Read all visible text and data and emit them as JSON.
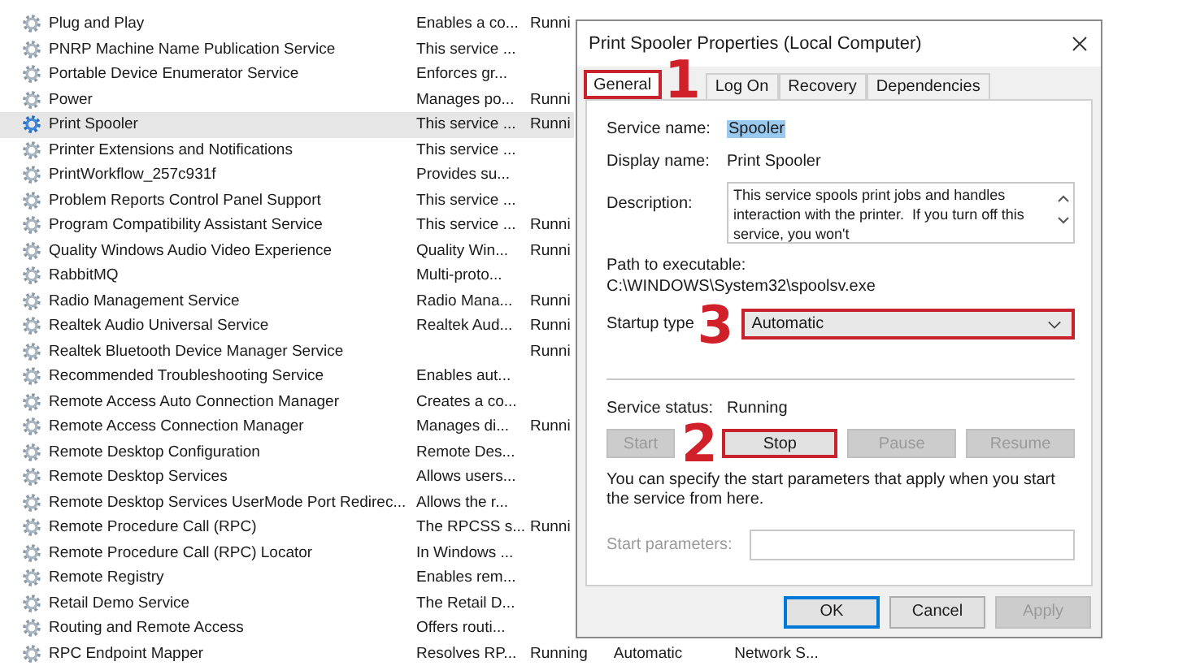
{
  "services": [
    {
      "name": "Plug and Play",
      "description": "Enables a co...",
      "status": "Runni",
      "selected": false
    },
    {
      "name": "PNRP Machine Name Publication Service",
      "description": "This service ...",
      "selected": false
    },
    {
      "name": "Portable Device Enumerator Service",
      "description": "Enforces gr...",
      "selected": false
    },
    {
      "name": "Power",
      "description": "Manages po...",
      "status": "Runni",
      "selected": false
    },
    {
      "name": "Print Spooler",
      "description": "This service ...",
      "status": "Runni",
      "selected": true
    },
    {
      "name": "Printer Extensions and Notifications",
      "description": "This service ...",
      "selected": false
    },
    {
      "name": "PrintWorkflow_257c931f",
      "description": "Provides su...",
      "selected": false
    },
    {
      "name": "Problem Reports Control Panel Support",
      "description": "This service ...",
      "selected": false
    },
    {
      "name": "Program Compatibility Assistant Service",
      "description": "This service ...",
      "status": "Runni",
      "selected": false
    },
    {
      "name": "Quality Windows Audio Video Experience",
      "description": "Quality Win...",
      "status": "Runni",
      "selected": false
    },
    {
      "name": "RabbitMQ",
      "description": "Multi-proto...",
      "selected": false
    },
    {
      "name": "Radio Management Service",
      "description": "Radio Mana...",
      "status": "Runni",
      "selected": false
    },
    {
      "name": "Realtek Audio Universal Service",
      "description": "Realtek Aud...",
      "status": "Runni",
      "selected": false
    },
    {
      "name": "Realtek Bluetooth Device Manager Service",
      "status": "Runni",
      "selected": false
    },
    {
      "name": "Recommended Troubleshooting Service",
      "description": "Enables aut...",
      "selected": false
    },
    {
      "name": "Remote Access Auto Connection Manager",
      "description": "Creates a co...",
      "selected": false
    },
    {
      "name": "Remote Access Connection Manager",
      "description": "Manages di...",
      "status": "Runni",
      "selected": false
    },
    {
      "name": "Remote Desktop Configuration",
      "description": "Remote Des...",
      "selected": false
    },
    {
      "name": "Remote Desktop Services",
      "description": "Allows users...",
      "selected": false
    },
    {
      "name": "Remote Desktop Services UserMode Port Redirec...",
      "description": "Allows the r...",
      "selected": false
    },
    {
      "name": "Remote Procedure Call (RPC)",
      "description": "The RPCSS s...",
      "status": "Runni",
      "selected": false
    },
    {
      "name": "Remote Procedure Call (RPC) Locator",
      "description": "In Windows ...",
      "selected": false
    },
    {
      "name": "Remote Registry",
      "description": "Enables rem...",
      "selected": false
    },
    {
      "name": "Retail Demo Service",
      "description": "The Retail D...",
      "selected": false
    },
    {
      "name": "Routing and Remote Access",
      "description": "Offers routi...",
      "selected": false
    },
    {
      "name": "RPC Endpoint Mapper",
      "description": "Resolves RP...",
      "status": "Running",
      "startup_type": "Automatic",
      "log_on_as": "Network S...",
      "selected": false
    }
  ],
  "dialog": {
    "title": "Print Spooler Properties (Local Computer)",
    "tabs": [
      {
        "label": "General",
        "selected": true,
        "highlighted": true,
        "step": "1"
      },
      {
        "label": "Log On",
        "selected": false,
        "highlighted": false
      },
      {
        "label": "Recovery",
        "selected": false,
        "highlighted": false
      },
      {
        "label": "Dependencies",
        "selected": false,
        "highlighted": false
      }
    ],
    "service_name": {
      "label": "Service name:",
      "value": "Spooler",
      "value_selected": true
    },
    "display_name": {
      "label": "Display name:",
      "value": "Print Spooler"
    },
    "description": {
      "label": "Description:",
      "value": "This service spools print jobs and handles interaction with the printer.  If you turn off this service, you won't"
    },
    "path": {
      "label": "Path to executable:",
      "value": "C:\\WINDOWS\\System32\\spoolsv.exe"
    },
    "startup_type": {
      "label": "Startup type",
      "value": "Automatic",
      "highlighted": true,
      "step": "3"
    },
    "service_status": {
      "label": "Service status:",
      "value": "Running"
    },
    "control_buttons": [
      {
        "label": "Start",
        "disabled": true,
        "highlighted": false
      },
      {
        "label": "Stop",
        "disabled": false,
        "highlighted": true,
        "step": "2"
      },
      {
        "label": "Pause",
        "disabled": true,
        "highlighted": false
      },
      {
        "label": "Resume",
        "disabled": true,
        "highlighted": false
      }
    ],
    "hint": "You can specify the start parameters that apply when you start the service from here.",
    "start_parameters": {
      "label": "Start parameters:",
      "disabled": true
    },
    "footer_buttons": [
      {
        "label": "OK",
        "disabled": false,
        "default": true
      },
      {
        "label": "Cancel",
        "disabled": false,
        "default": false
      },
      {
        "label": "Apply",
        "disabled": true,
        "default": false
      }
    ]
  }
}
